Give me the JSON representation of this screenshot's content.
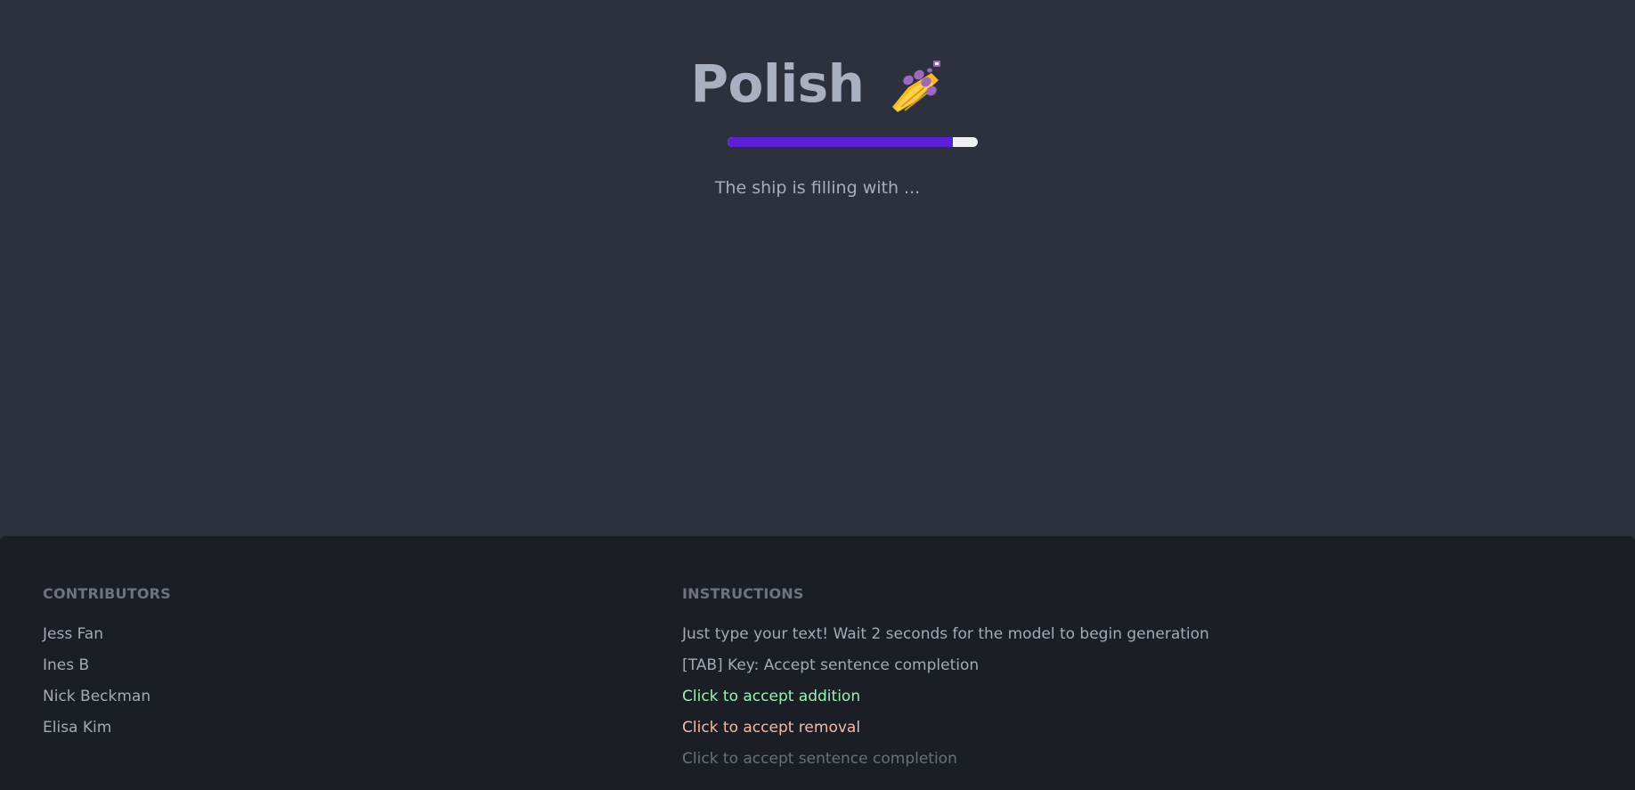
{
  "header": {
    "title": "Polish",
    "title_icon": "nail-polish-icon",
    "progress": 0.9
  },
  "status_text": "The ship is filling with ...",
  "contributors": {
    "heading": "CONTRIBUTORS",
    "names": [
      "Jess Fan",
      "Ines B",
      "Nick Beckman",
      "Elisa Kim"
    ]
  },
  "instructions": {
    "heading": "INSTRUCTIONS",
    "items": [
      "Just type your text! Wait 2 seconds for the model to begin generation",
      "[TAB] Key: Accept sentence completion",
      "Click to accept addition",
      "Click to accept removal",
      "Click to accept sentence completion"
    ]
  },
  "colors": {
    "background": "#2c313d",
    "footer_background": "#1b1e25",
    "accent": "#5b1fd6",
    "addition": "#9bf0b6",
    "removal": "#f7b7a6",
    "completion": "#6a707b"
  }
}
